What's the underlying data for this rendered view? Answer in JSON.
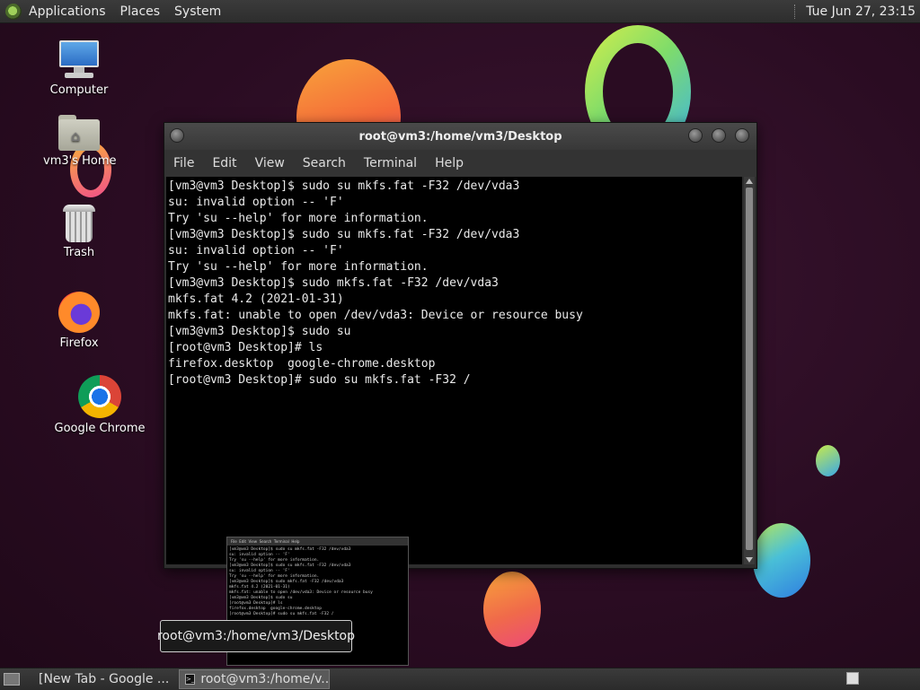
{
  "top_panel": {
    "menus": [
      "Applications",
      "Places",
      "System"
    ],
    "clock": "Tue Jun 27, 23:15"
  },
  "desktop_icons": {
    "computer": "Computer",
    "home": "vm3's Home",
    "trash": "Trash",
    "firefox": "Firefox",
    "chrome": "Google Chrome"
  },
  "terminal": {
    "title": "root@vm3:/home/vm3/Desktop",
    "menu": [
      "File",
      "Edit",
      "View",
      "Search",
      "Terminal",
      "Help"
    ],
    "lines": [
      "[vm3@vm3 Desktop]$ sudo su mkfs.fat -F32 /dev/vda3",
      "su: invalid option -- 'F'",
      "Try 'su --help' for more information.",
      "[vm3@vm3 Desktop]$ sudo su mkfs.fat -F32 /dev/vda3",
      "su: invalid option -- 'F'",
      "Try 'su --help' for more information.",
      "[vm3@vm3 Desktop]$ sudo mkfs.fat -F32 /dev/vda3",
      "mkfs.fat 4.2 (2021-01-31)",
      "mkfs.fat: unable to open /dev/vda3: Device or resource busy",
      "[vm3@vm3 Desktop]$ sudo su",
      "[root@vm3 Desktop]# ls",
      "firefox.desktop  google-chrome.desktop",
      "[root@vm3 Desktop]# sudo su mkfs.fat -F32 /"
    ]
  },
  "tooltip": "root@vm3:/home/vm3/Desktop",
  "taskbar": {
    "tasks": [
      {
        "label": "[New Tab - Google ...",
        "icon": "chrome-icon"
      },
      {
        "label": "root@vm3:/home/v...",
        "icon": "terminal-icon"
      }
    ]
  },
  "colors": {
    "panel_bg": "#333333",
    "terminal_bg": "#000000",
    "terminal_fg": "#eaeaea",
    "wallpaper": "#2a0c22"
  }
}
